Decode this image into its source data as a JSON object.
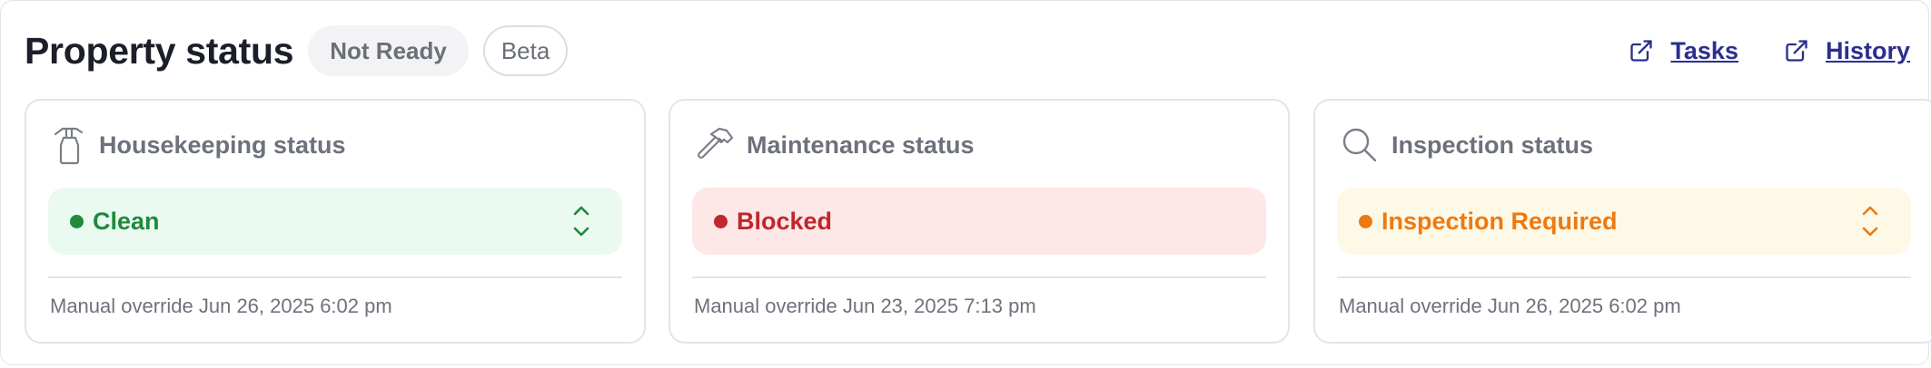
{
  "header": {
    "title": "Property status",
    "badge_status": "Not Ready",
    "badge_beta": "Beta",
    "links": [
      {
        "label": "Tasks",
        "icon": "external-link-icon"
      },
      {
        "label": "History",
        "icon": "external-link-icon"
      }
    ]
  },
  "colors": {
    "clean_bg": "#eafaf1",
    "clean_fg": "#1f8a3b",
    "blocked_bg": "#fde7e7",
    "blocked_fg": "#c0262d",
    "inspection_bg": "#fef9e7",
    "inspection_fg": "#ec7a13",
    "link": "#2b2f8f"
  },
  "cards": [
    {
      "title": "Housekeeping status",
      "icon": "spray-bottle-icon",
      "status": "Clean",
      "has_select": true,
      "footnote": "Manual override Jun 26, 2025 6:02 pm"
    },
    {
      "title": "Maintenance status",
      "icon": "hammer-icon",
      "status": "Blocked",
      "has_select": false,
      "footnote": "Manual override Jun 23, 2025 7:13 pm"
    },
    {
      "title": "Inspection status",
      "icon": "magnifier-icon",
      "status": "Inspection Required",
      "has_select": true,
      "footnote": "Manual override Jun 26, 2025 6:02 pm"
    }
  ]
}
